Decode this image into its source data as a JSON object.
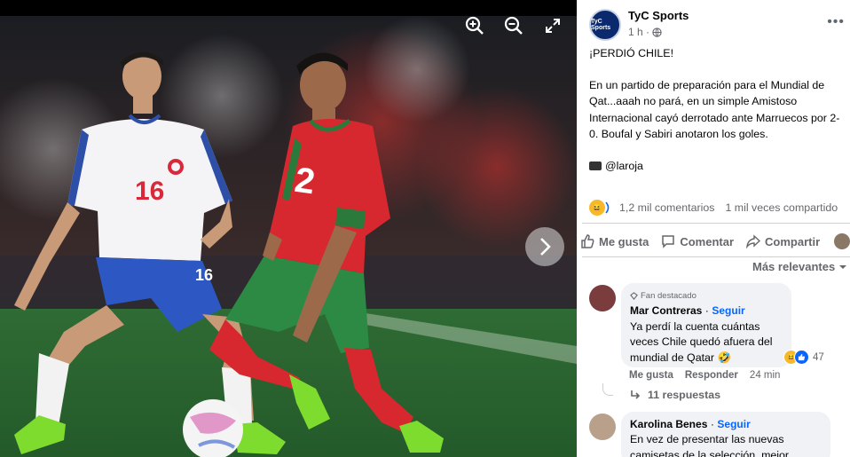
{
  "photo": {
    "controls": [
      {
        "name": "zoom-in-icon"
      },
      {
        "name": "zoom-out-icon"
      },
      {
        "name": "fullscreen-icon"
      }
    ],
    "next_icon": "chevron-right-icon"
  },
  "post": {
    "page_name": "TyC Sports",
    "page_logo_text": "TyC Sports",
    "time": "1 h ·",
    "headline": "¡PERDIÓ CHILE!",
    "body": "En un partido de preparación para el Mundial de Qat...aaah no pará, en un simple Amistoso Internacional cayó derrotado ante Marruecos por 2-0. Boufal y Sabiri anotaron los goles.",
    "credit": "@laroja",
    "comments_count": "1,2 mil comentarios",
    "shares_count": "1 mil veces compartido"
  },
  "actions": {
    "like": "Me gusta",
    "comment": "Comentar",
    "share": "Compartir"
  },
  "sort_label": "Más relevantes",
  "comments": [
    {
      "badge": "Fan destacado",
      "author": "Mar Contreras",
      "follow": "Seguir",
      "text": "Ya perdí la cuenta cuántas veces Chile quedó afuera del mundial de Qatar",
      "reaction_count": "47",
      "like": "Me gusta",
      "reply": "Responder",
      "time": "24 min",
      "replies": "11 respuestas"
    },
    {
      "author": "Karolina Benes",
      "follow": "Seguir",
      "text": "En vez de presentar las nuevas camisetas de la selección, mejor"
    }
  ],
  "colors": {
    "accent": "#0866ff",
    "muted": "#65676b",
    "bubble": "#f0f2f5",
    "chile_shirt": "#ffffff",
    "morocco_shirt": "#d7282f",
    "pitch": "#2f6b34"
  }
}
